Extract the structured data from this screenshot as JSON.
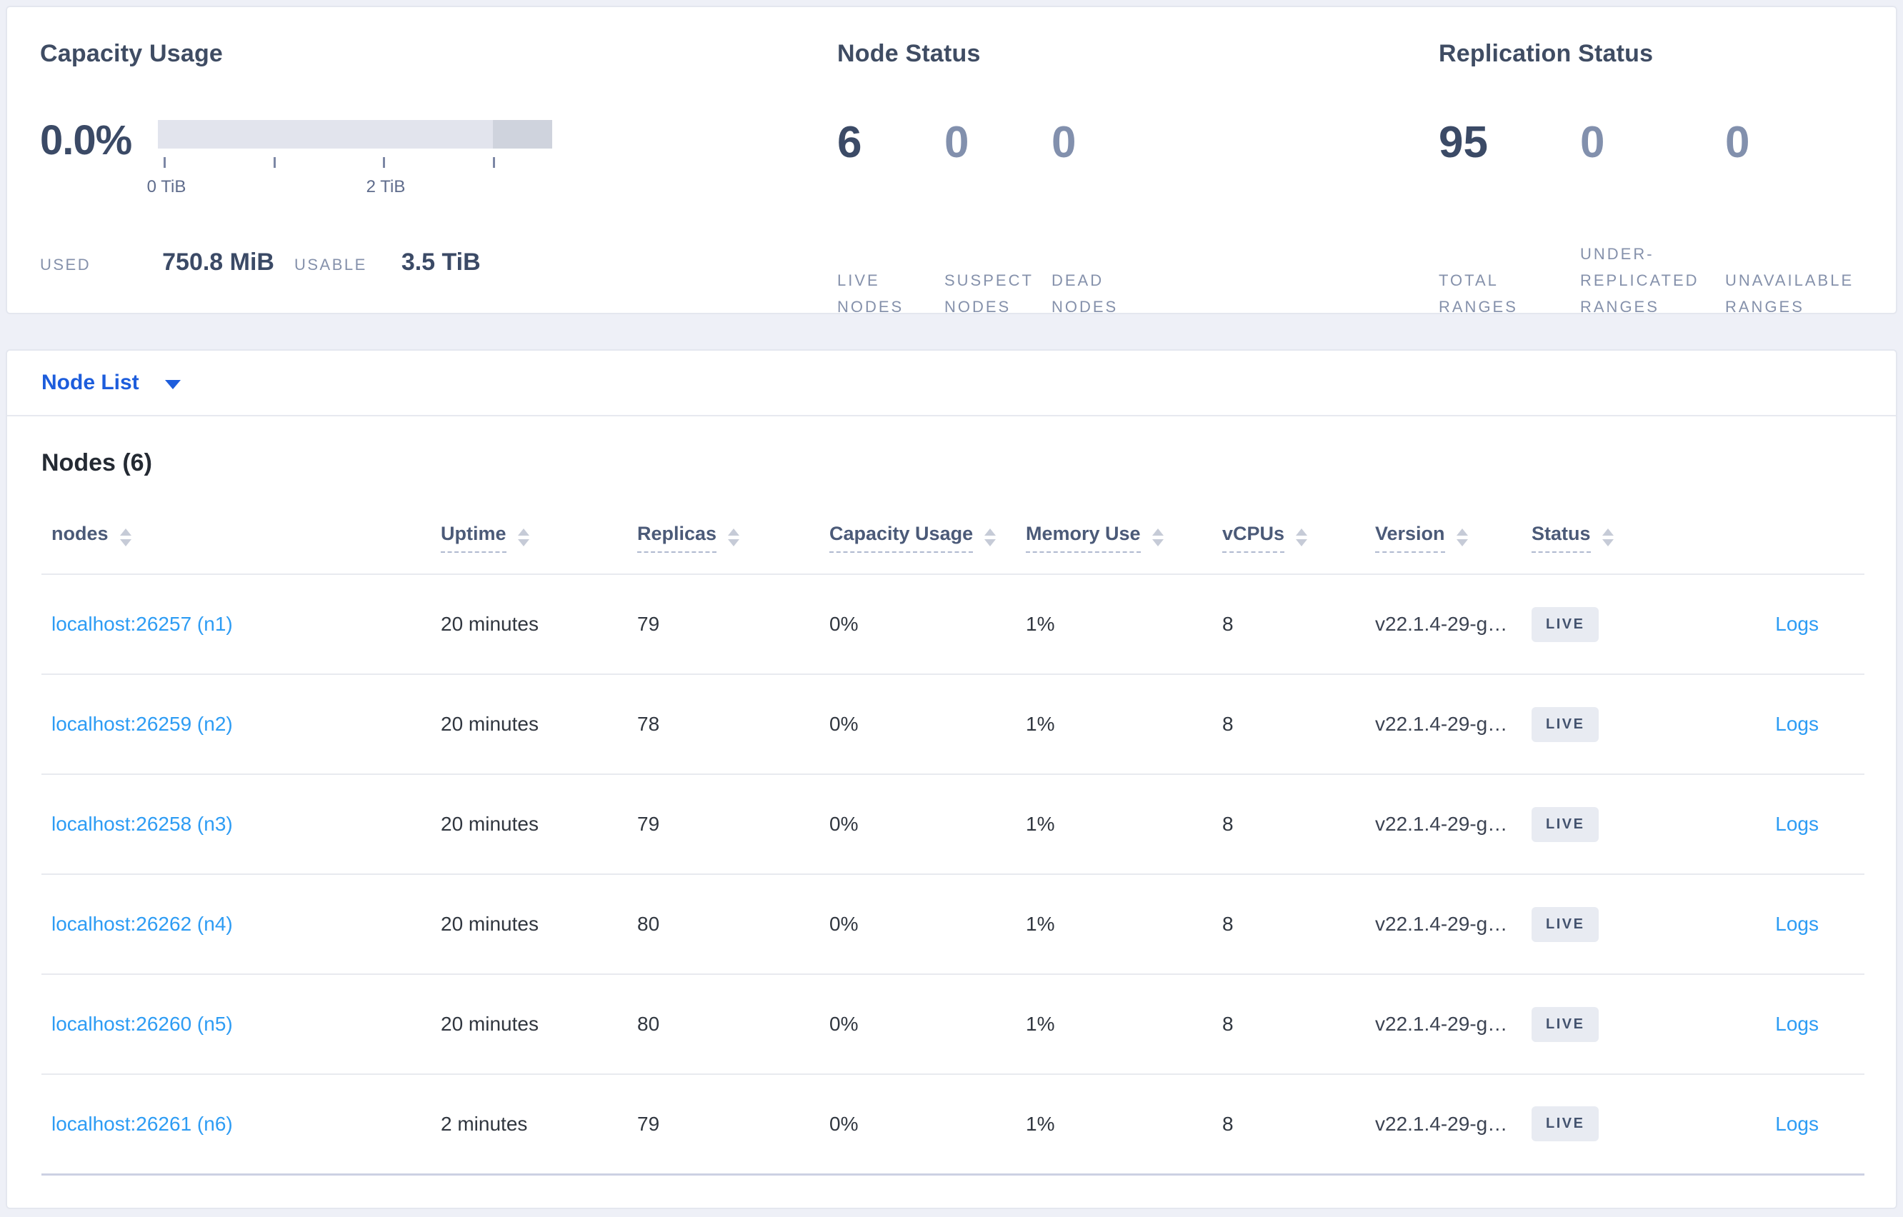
{
  "summary": {
    "capacity": {
      "title": "Capacity Usage",
      "percent": "0.0%",
      "tick_labels": [
        "0 TiB",
        "2 TiB"
      ],
      "used_label": "USED",
      "used_value": "750.8 MiB",
      "usable_label": "USABLE",
      "usable_value": "3.5 TiB"
    },
    "node_status": {
      "title": "Node Status",
      "stats": [
        {
          "value": "6",
          "label": "LIVE NODES"
        },
        {
          "value": "0",
          "label": "SUSPECT NODES"
        },
        {
          "value": "0",
          "label": "DEAD NODES"
        }
      ]
    },
    "replication": {
      "title": "Replication Status",
      "stats": [
        {
          "value": "95",
          "label": "TOTAL RANGES"
        },
        {
          "value": "0",
          "label": "UNDER-REPLICATED RANGES"
        },
        {
          "value": "0",
          "label": "UNAVAILABLE RANGES"
        }
      ]
    }
  },
  "node_list": {
    "dropdown_label": "Node List",
    "heading": "Nodes (6)",
    "columns": [
      {
        "label": "nodes"
      },
      {
        "label": "Uptime"
      },
      {
        "label": "Replicas"
      },
      {
        "label": "Capacity Usage"
      },
      {
        "label": "Memory Use"
      },
      {
        "label": "vCPUs"
      },
      {
        "label": "Version"
      },
      {
        "label": "Status"
      },
      {
        "label": ""
      }
    ],
    "rows": [
      {
        "node": "localhost:26257 (n1)",
        "uptime": "20 minutes",
        "replicas": "79",
        "capacity_usage": "0%",
        "memory_use": "1%",
        "vcpus": "8",
        "version": "v22.1.4-29-g…",
        "status": "LIVE",
        "logs_label": "Logs"
      },
      {
        "node": "localhost:26259 (n2)",
        "uptime": "20 minutes",
        "replicas": "78",
        "capacity_usage": "0%",
        "memory_use": "1%",
        "vcpus": "8",
        "version": "v22.1.4-29-g…",
        "status": "LIVE",
        "logs_label": "Logs"
      },
      {
        "node": "localhost:26258 (n3)",
        "uptime": "20 minutes",
        "replicas": "79",
        "capacity_usage": "0%",
        "memory_use": "1%",
        "vcpus": "8",
        "version": "v22.1.4-29-g…",
        "status": "LIVE",
        "logs_label": "Logs"
      },
      {
        "node": "localhost:26262 (n4)",
        "uptime": "20 minutes",
        "replicas": "80",
        "capacity_usage": "0%",
        "memory_use": "1%",
        "vcpus": "8",
        "version": "v22.1.4-29-g…",
        "status": "LIVE",
        "logs_label": "Logs"
      },
      {
        "node": "localhost:26260 (n5)",
        "uptime": "20 minutes",
        "replicas": "80",
        "capacity_usage": "0%",
        "memory_use": "1%",
        "vcpus": "8",
        "version": "v22.1.4-29-g…",
        "status": "LIVE",
        "logs_label": "Logs"
      },
      {
        "node": "localhost:26261 (n6)",
        "uptime": "2 minutes",
        "replicas": "79",
        "capacity_usage": "0%",
        "memory_use": "1%",
        "vcpus": "8",
        "version": "v22.1.4-29-g…",
        "status": "LIVE",
        "logs_label": "Logs"
      }
    ]
  },
  "colors": {
    "page_background": "#eef0f7",
    "panel_background": "#ffffff",
    "accent_link_blue": "#2d9cf4",
    "dropdown_blue": "#1d5ddc",
    "dark_slate": "#3b4a66",
    "muted_label": "#8591ab",
    "bar_light": "#e2e4ed",
    "bar_dark": "#cfd3dd",
    "badge_background": "#e8ebf2",
    "badge_text": "#44536f"
  }
}
